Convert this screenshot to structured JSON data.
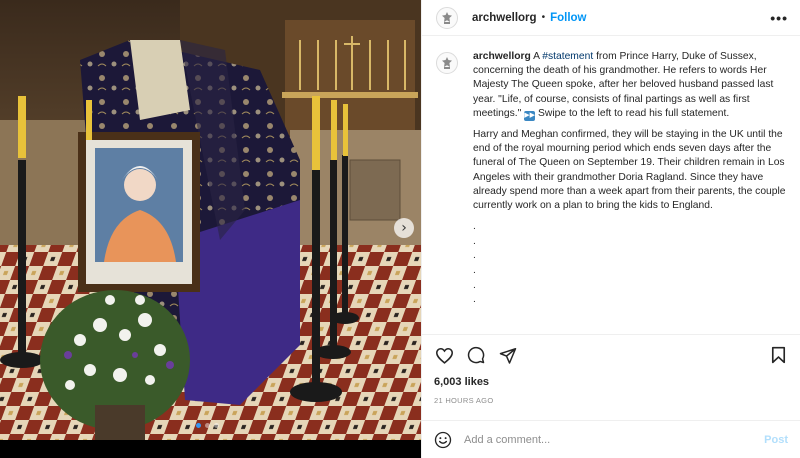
{
  "post": {
    "username": "archwellorg",
    "separator": "•",
    "follow_label": "Follow",
    "more_label": "•••",
    "caption": {
      "username": "archwellorg",
      "part1": " A ",
      "hashtag": "#statement",
      "part2": " from Prince Harry, Duke of Sussex, concerning the death of his grandmother. He refers to words Her Majesty The Queen spoke, after her beloved husband passed last year. \"Life, of course, consists of final partings as well as first meetings.\" ",
      "emoji": "▶▶",
      "part3": " Swipe to the left to read his full statement.",
      "paragraph2": "Harry and Meghan confirmed, they will be staying in the UK until the end of the royal mourning period which ends seven days after the funeral of The Queen on September 19. Their children remain in Los Angeles with their grandmother Doria Ragland. Since they have already spend more than a week apart from their parents, the couple currently work on a plan to bring the kids to England.",
      "dots": [
        ".",
        ".",
        ".",
        ".",
        ".",
        "."
      ]
    },
    "likes": "6,003 likes",
    "timestamp": "21 HOURS AGO",
    "comment_placeholder": "Add a comment...",
    "post_label": "Post"
  },
  "media": {
    "carousel_next": "›",
    "carousel_count": 3,
    "carousel_active": 1
  },
  "icons": {
    "like": "heart-icon",
    "comment": "comment-icon",
    "share": "share-icon",
    "save": "bookmark-icon",
    "emoji": "smile-icon",
    "next": "chevron-right-icon"
  },
  "colors": {
    "link": "#0095f6",
    "hashtag": "#00376b",
    "post_disabled": "#b2dffc",
    "active_dot": "#3797f0"
  }
}
